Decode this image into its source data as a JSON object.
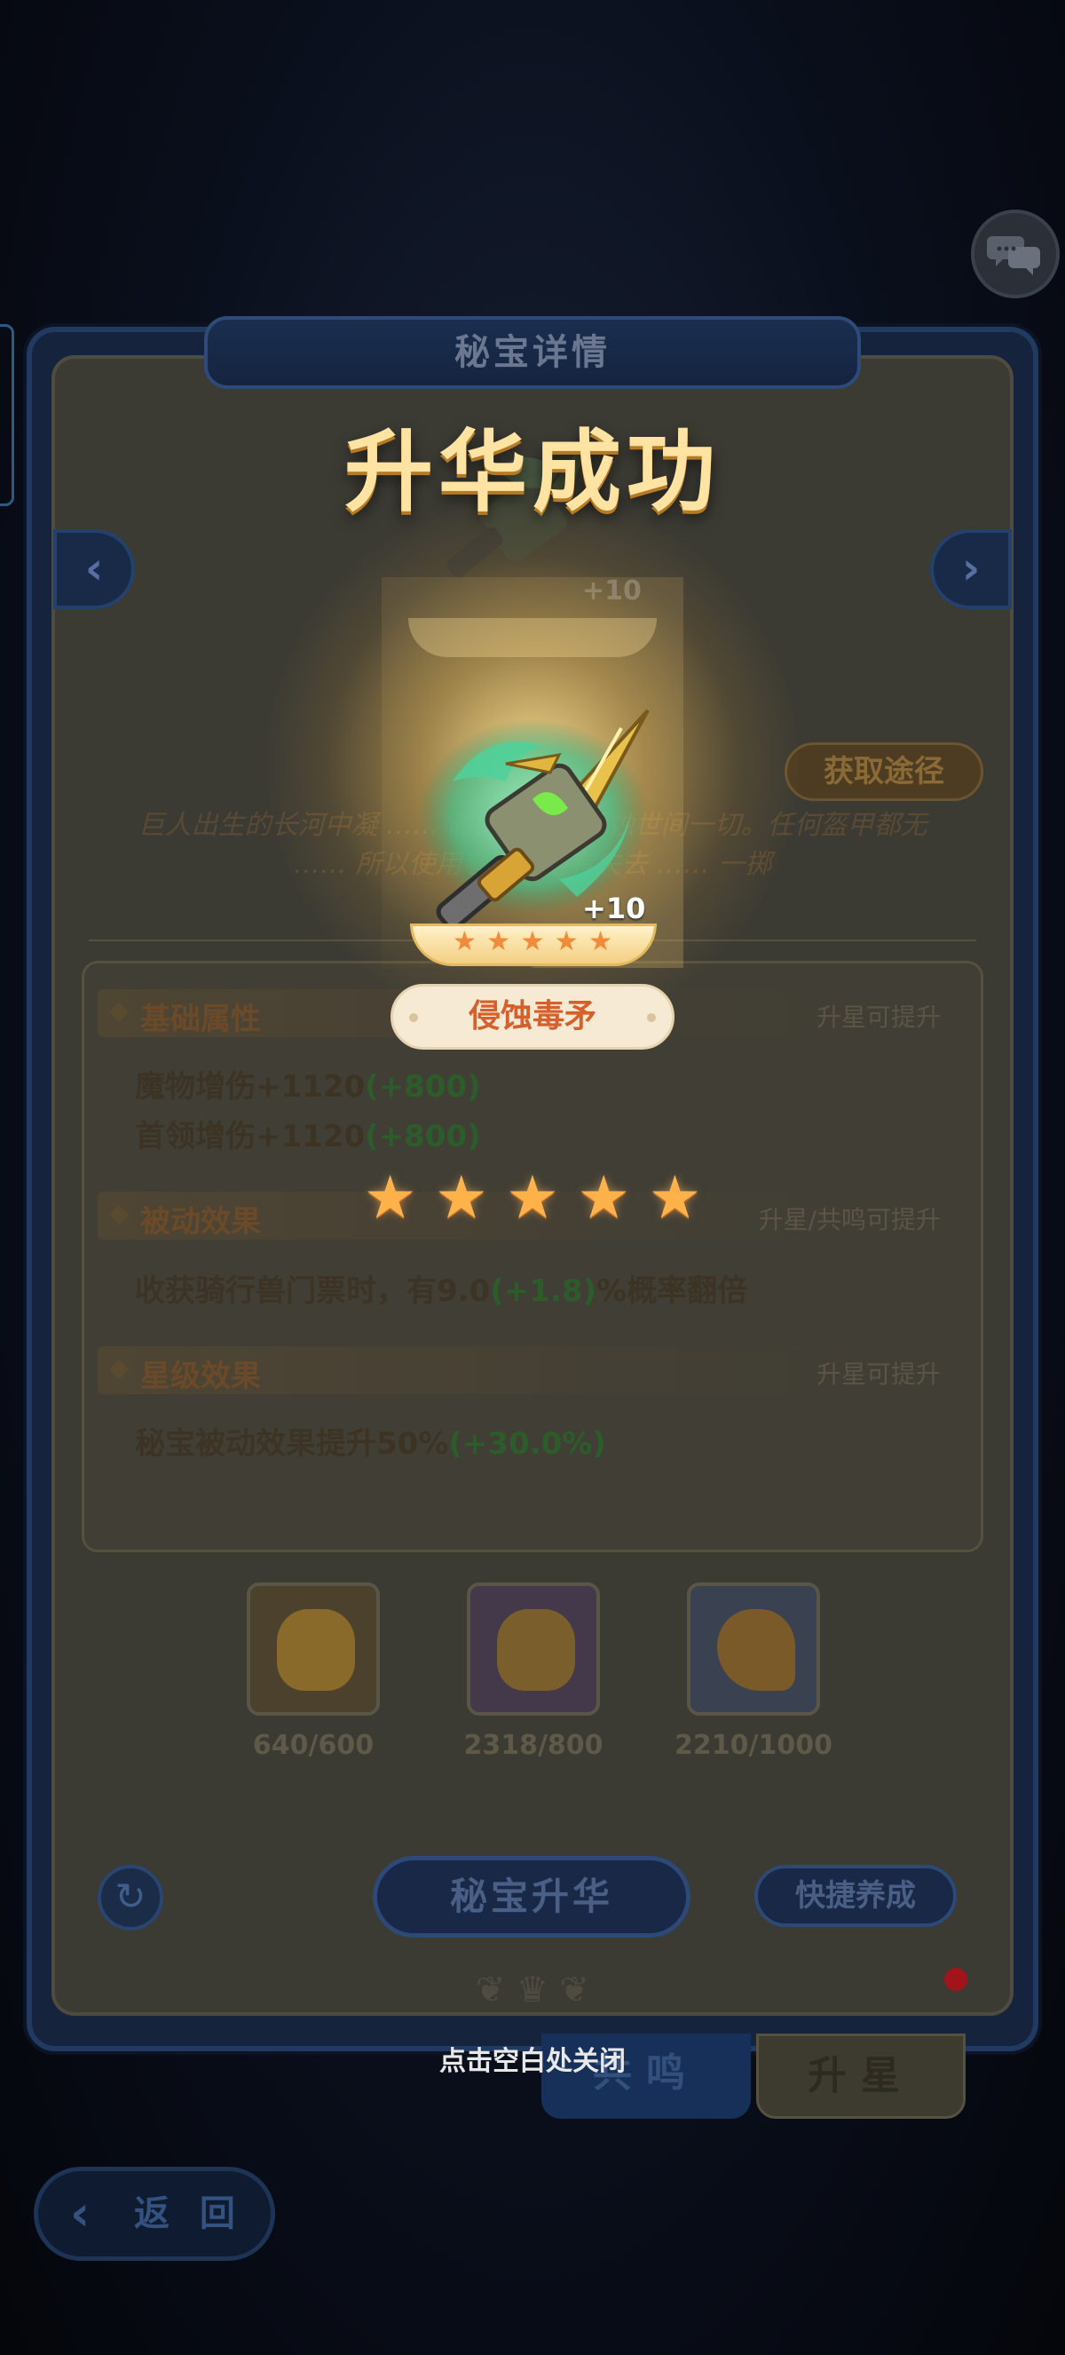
{
  "panel": {
    "title": "秘宝详情",
    "get_path_label": "获取途径",
    "description": "巨人出生的长河中凝 …… 着的毒足矣侵蚀世间一切。任何盔甲都无 …… 所以使用者必须抱有失去 …… 一掷"
  },
  "sections": {
    "basic": {
      "title": "基础属性",
      "hint": "升星可提升",
      "lines": [
        {
          "text": "魔物增伤+1120",
          "plus": "(+800)"
        },
        {
          "text": "首领增伤+1120",
          "plus": "(+800)"
        }
      ]
    },
    "passive": {
      "title": "被动效果",
      "hint": "升星/共鸣可提升",
      "line": {
        "prefix": "收获骑行兽门票时，有9.0",
        "plus": "(+1.8)",
        "suffix": "%概率翻倍"
      }
    },
    "star": {
      "title": "星级效果",
      "hint": "升星可提升",
      "line": {
        "text": "秘宝被动效果提升50%",
        "plus": "(+30.0%)"
      }
    }
  },
  "materials": [
    {
      "count": "640/600",
      "color": "#8a6a2a"
    },
    {
      "count": "2318/800",
      "color": "#6c3fa0"
    },
    {
      "count": "2210/1000",
      "color": "#2c5a96"
    }
  ],
  "buttons": {
    "upgrade": "秘宝升华",
    "quick": "快捷养成",
    "back": "返 回",
    "resonance_tab": "共鸣",
    "star_tab": "升星"
  },
  "overlay": {
    "success_title": "升华成功",
    "item_name": "侵蚀毒矛",
    "item_level": "+10",
    "previous_level": "+10",
    "stars": 5,
    "close_hint": "点击空白处关闭"
  },
  "icons": {
    "chat": "chat-bubbles-icon",
    "refresh": "refresh-icon",
    "back": "back-arrow-icon",
    "prev": "chevron-left-icon",
    "next": "chevron-right-icon",
    "star": "star-icon"
  }
}
